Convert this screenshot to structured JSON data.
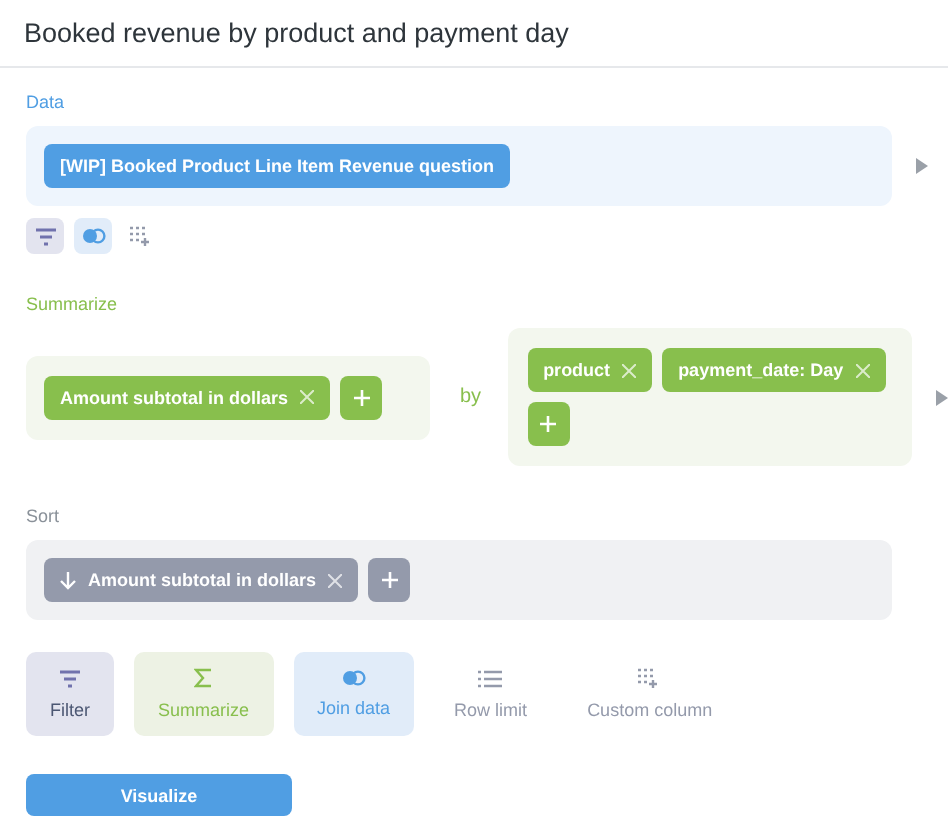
{
  "title": "Booked revenue by product and payment day",
  "data": {
    "label": "Data",
    "source": "[WIP] Booked Product Line Item Revenue question",
    "tools": [
      {
        "kind": "filter",
        "active": true
      },
      {
        "kind": "join",
        "active": true
      },
      {
        "kind": "custom",
        "active": false
      }
    ]
  },
  "summarize": {
    "label": "Summarize",
    "metrics": [
      {
        "label": "Amount subtotal in dollars"
      }
    ],
    "by": "by",
    "breakouts": [
      {
        "label": "product"
      },
      {
        "label": "payment_date: Day"
      }
    ]
  },
  "sort": {
    "label": "Sort",
    "items": [
      {
        "label": "Amount subtotal in dollars",
        "kind": "descending"
      }
    ]
  },
  "actions": [
    {
      "kind": "filter",
      "label": "Filter"
    },
    {
      "kind": "summarize",
      "label": "Summarize"
    },
    {
      "kind": "join",
      "label": "Join data"
    },
    {
      "kind": "limit",
      "label": "Row limit"
    },
    {
      "kind": "custom",
      "label": "Custom column"
    }
  ],
  "visualize": "Visualize"
}
